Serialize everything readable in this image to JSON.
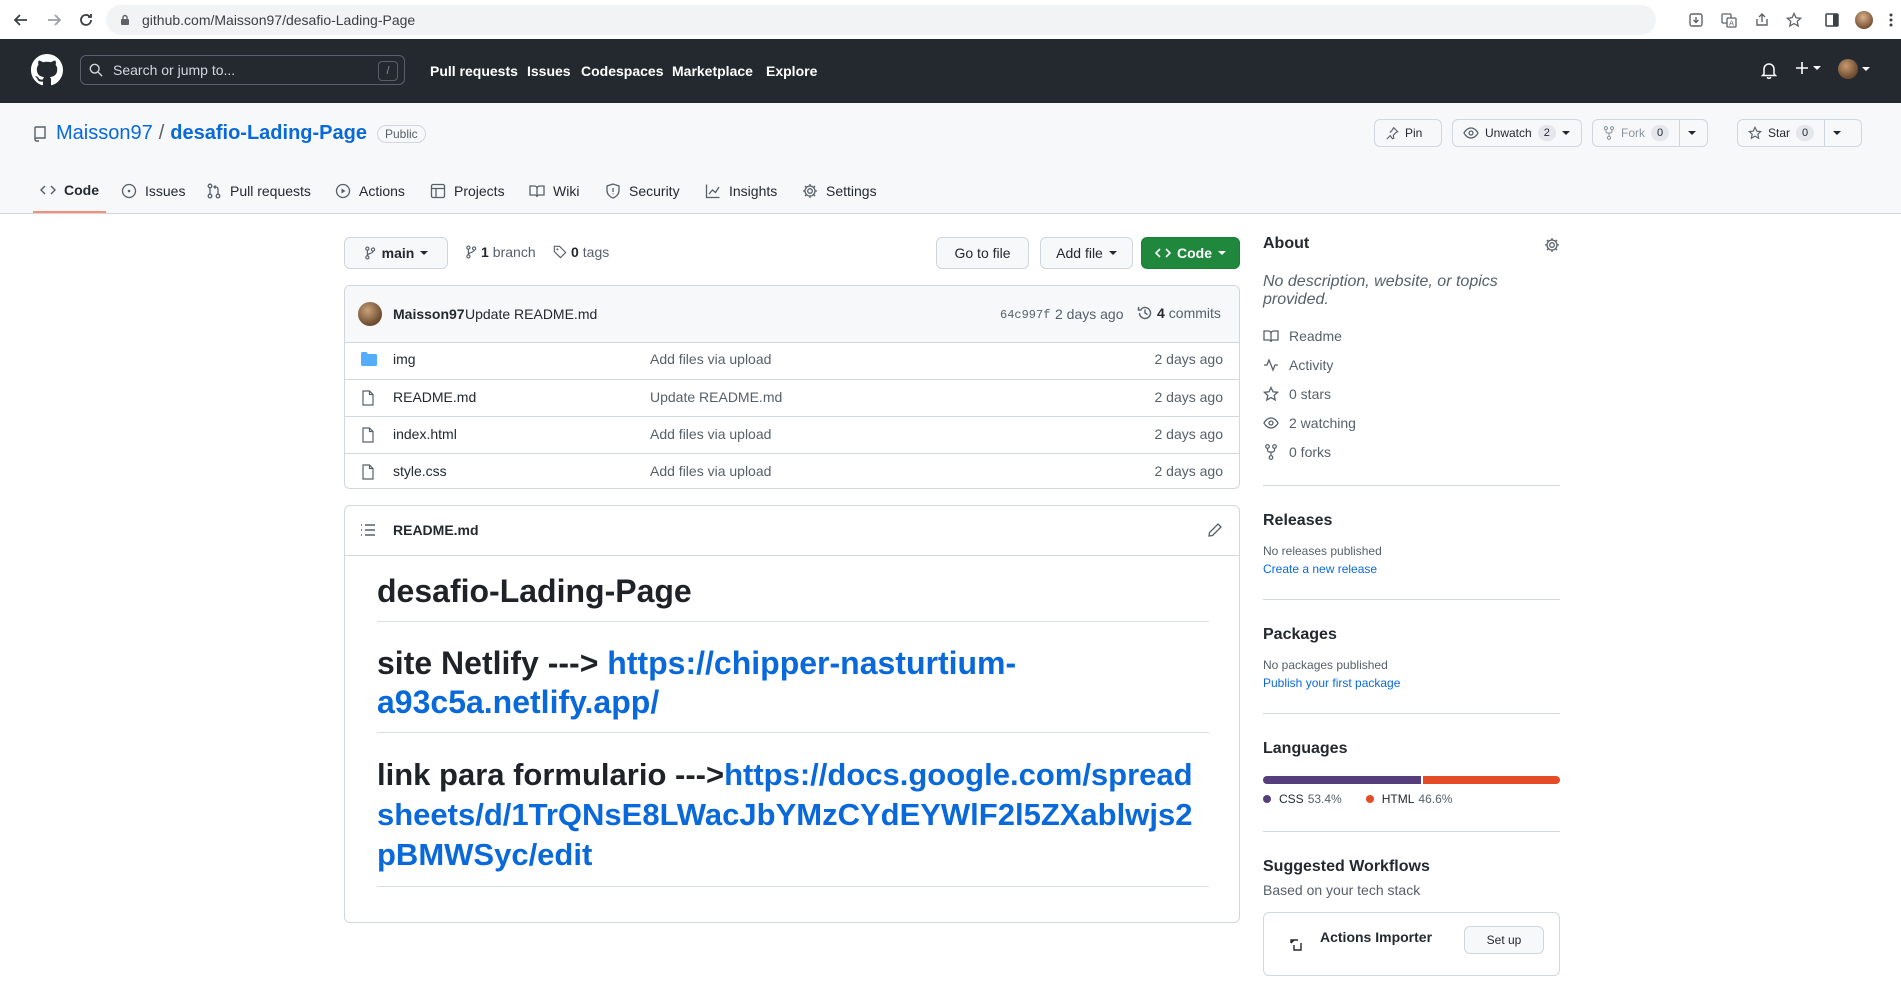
{
  "browser": {
    "url": "github.com/Maisson97/desafio-Lading-Page"
  },
  "header": {
    "search_placeholder": "Search or jump to...",
    "slash_key": "/",
    "nav": [
      "Pull requests",
      "Issues",
      "Codespaces",
      "Marketplace",
      "Explore"
    ]
  },
  "repo": {
    "owner": "Maisson97",
    "separator": "/",
    "name": "desafio-Lading-Page",
    "visibility": "Public",
    "pin_label": "Pin",
    "unwatch_label": "Unwatch",
    "watch_count": "2",
    "fork_label": "Fork",
    "fork_count": "0",
    "star_label": "Star",
    "star_count": "0",
    "tabs": [
      "Code",
      "Issues",
      "Pull requests",
      "Actions",
      "Projects",
      "Wiki",
      "Security",
      "Insights",
      "Settings"
    ]
  },
  "toolbar": {
    "branch": "main",
    "branch_count": "1",
    "branch_word": "branch",
    "tag_count": "0",
    "tag_word": "tags",
    "go_to_file": "Go to file",
    "add_file": "Add file",
    "code": "Code"
  },
  "commit": {
    "author": "Maisson97",
    "message": "Update README.md",
    "sha": "64c997f",
    "time": "2 days ago",
    "count": "4",
    "count_word": "commits"
  },
  "files": [
    {
      "name": "img",
      "type": "folder",
      "message": "Add files via upload",
      "time": "2 days ago"
    },
    {
      "name": "README.md",
      "type": "file",
      "message": "Update README.md",
      "time": "2 days ago"
    },
    {
      "name": "index.html",
      "type": "file",
      "message": "Add files via upload",
      "time": "2 days ago"
    },
    {
      "name": "style.css",
      "type": "file",
      "message": "Add files via upload",
      "time": "2 days ago"
    }
  ],
  "readme": {
    "filename": "README.md",
    "title": "desafio-Lading-Page",
    "netlify_prefix": "site Netlify ---> ",
    "netlify_link": "https://chipper-nasturtium-a93c5a.netlify.app/",
    "form_prefix": "link para formulario --->",
    "form_link": "https://docs.google.com/spreadsheets/d/1TrQNsE8LWacJbYMzCYdEYWlF2l5ZXablwjs2pBMWSyc/edit"
  },
  "about": {
    "title": "About",
    "description": "No description, website, or topics provided.",
    "readme": "Readme",
    "activity": "Activity",
    "stars": "0 stars",
    "watching": "2 watching",
    "forks": "0 forks"
  },
  "releases": {
    "title": "Releases",
    "empty": "No releases published",
    "link": "Create a new release"
  },
  "packages": {
    "title": "Packages",
    "empty": "No packages published",
    "link": "Publish your first package"
  },
  "languages": {
    "title": "Languages",
    "items": [
      {
        "name": "CSS",
        "percent": "53.4%",
        "value": 53.4,
        "color": "#563d7c"
      },
      {
        "name": "HTML",
        "percent": "46.6%",
        "value": 46.6,
        "color": "#e34c26"
      }
    ]
  },
  "workflows": {
    "title": "Suggested Workflows",
    "subtitle": "Based on your tech stack",
    "item_name": "Actions Importer",
    "setup": "Set up"
  }
}
